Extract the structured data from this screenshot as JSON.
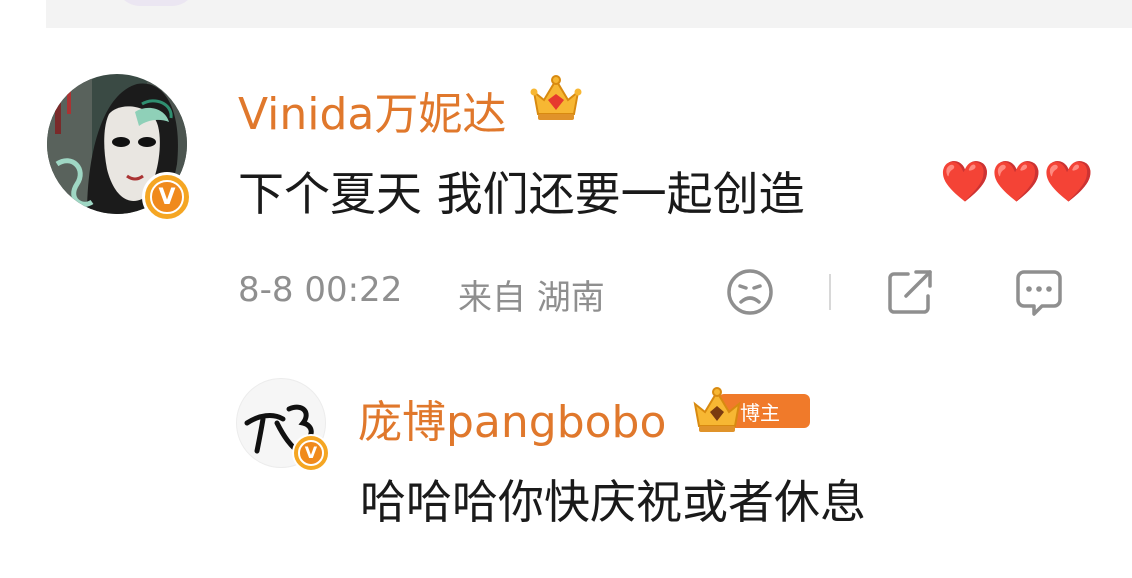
{
  "comment": {
    "author": "Vinida万妮达",
    "text": "下个夏天 我们还要一起创造",
    "emojis": [
      "❤️",
      "❤️",
      "❤️"
    ],
    "time": "8-8 00:22",
    "location": "来自 湖南",
    "verified_badge": "V"
  },
  "reply": {
    "author": "庞博pangbobo",
    "author_tag": "博主",
    "text": "哈哈哈你快庆祝或者休息",
    "verified_badge": "V",
    "avatar_text": "pb"
  },
  "icons": {
    "dislike": "sad-face-icon",
    "share": "share-icon",
    "comment": "comment-bubble-icon",
    "crown": "crown-icon"
  },
  "colors": {
    "name": "#e0782c",
    "text": "#1a1a1a",
    "meta": "#8f8f8f",
    "badge": "#f5a623",
    "heart": "#e0281f"
  }
}
